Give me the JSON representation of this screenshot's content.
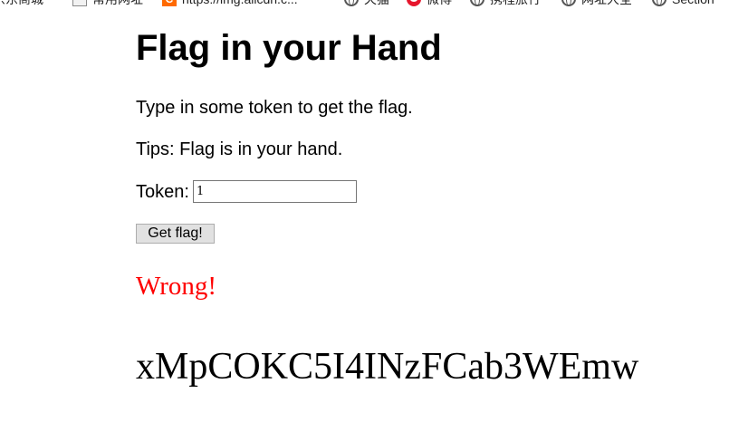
{
  "bookmarks": [
    {
      "label": "京东商城",
      "icon": "none"
    },
    {
      "label": "常用网址",
      "icon": "folder-icon"
    },
    {
      "label": "https://img.alicdn.c...",
      "icon": "alibaba-icon"
    },
    {
      "label": "天猫",
      "icon": "globe-icon"
    },
    {
      "label": "微博",
      "icon": "weibo-icon"
    },
    {
      "label": "携程旅行",
      "icon": "globe-icon"
    },
    {
      "label": "网址大全",
      "icon": "globe-icon"
    },
    {
      "label": "Section",
      "icon": "globe-icon"
    }
  ],
  "page": {
    "title": "Flag in your Hand",
    "instruction": "Type in some token to get the flag.",
    "tips": "Tips: Flag is in your hand.",
    "token_label": "Token:",
    "token_value": "1",
    "button_label": "Get flag!",
    "result": "Wrong!",
    "flag": "xMpCOKC5I4INzFCab3WEmw"
  },
  "colors": {
    "result": "#ff0000",
    "text": "#000000",
    "background": "#ffffff"
  }
}
